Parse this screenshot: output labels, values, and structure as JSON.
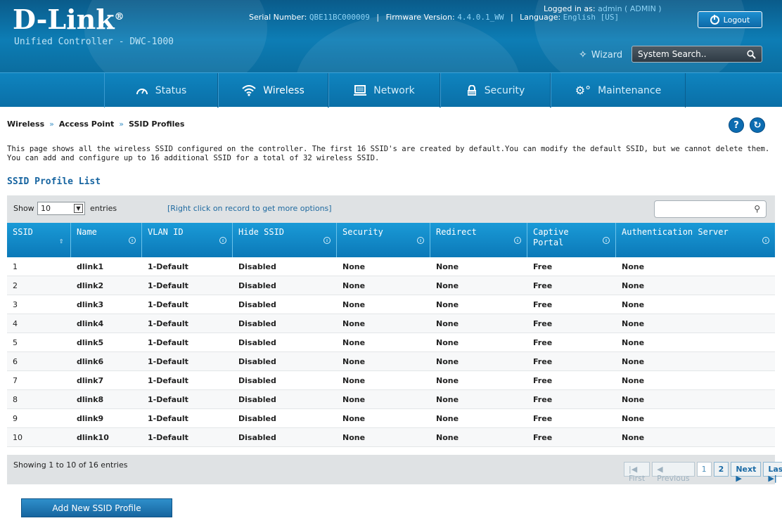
{
  "header": {
    "logo": "D-Link",
    "logo_mark": "®",
    "product": "Unified Controller - DWC-1000",
    "serial_label": "Serial Number:",
    "serial_value": "QBE11BC000009",
    "firmware_label": "Firmware Version:",
    "firmware_value": "4.4.0.1_WW",
    "language_label": "Language:",
    "language_value": "English [US]",
    "logged_in_label": "Logged in as:",
    "logged_in_value": "admin ( ADMIN )",
    "logout_label": "Logout",
    "wizard_label": "Wizard",
    "search_placeholder": "System Search.."
  },
  "nav": {
    "items": [
      {
        "label": "Status",
        "icon": "gauge-icon"
      },
      {
        "label": "Wireless",
        "icon": "wifi-icon"
      },
      {
        "label": "Network",
        "icon": "monitor-icon"
      },
      {
        "label": "Security",
        "icon": "lock-icon"
      },
      {
        "label": "Maintenance",
        "icon": "gears-icon"
      }
    ],
    "active": "Wireless"
  },
  "breadcrumb": [
    "Wireless",
    "Access Point",
    "SSID Profiles"
  ],
  "description": "This page shows all the wireless SSID configured on the controller. The first 16 SSID's are created by default.You can modify the default SSID, but we cannot delete them. You can add and configure up to 16 additional SSID for a total of 32 wireless SSID.",
  "section_title": "SSID Profile List",
  "toolbar": {
    "show_label": "Show",
    "show_value": "10",
    "entries_label": "entries",
    "hint": "[Right click on record to get more options]"
  },
  "table": {
    "columns": [
      "SSID",
      "Name",
      "VLAN ID",
      "Hide SSID",
      "Security",
      "Redirect",
      "Captive Portal",
      "Authentication Server"
    ],
    "rows": [
      [
        "1",
        "dlink1",
        "1-Default",
        "Disabled",
        "None",
        "None",
        "Free",
        "None"
      ],
      [
        "2",
        "dlink2",
        "1-Default",
        "Disabled",
        "None",
        "None",
        "Free",
        "None"
      ],
      [
        "3",
        "dlink3",
        "1-Default",
        "Disabled",
        "None",
        "None",
        "Free",
        "None"
      ],
      [
        "4",
        "dlink4",
        "1-Default",
        "Disabled",
        "None",
        "None",
        "Free",
        "None"
      ],
      [
        "5",
        "dlink5",
        "1-Default",
        "Disabled",
        "None",
        "None",
        "Free",
        "None"
      ],
      [
        "6",
        "dlink6",
        "1-Default",
        "Disabled",
        "None",
        "None",
        "Free",
        "None"
      ],
      [
        "7",
        "dlink7",
        "1-Default",
        "Disabled",
        "None",
        "None",
        "Free",
        "None"
      ],
      [
        "8",
        "dlink8",
        "1-Default",
        "Disabled",
        "None",
        "None",
        "Free",
        "None"
      ],
      [
        "9",
        "dlink9",
        "1-Default",
        "Disabled",
        "None",
        "None",
        "Free",
        "None"
      ],
      [
        "10",
        "dlink10",
        "1-Default",
        "Disabled",
        "None",
        "None",
        "Free",
        "None"
      ]
    ]
  },
  "footer": {
    "showing": "Showing 1 to 10 of 16 entries",
    "first": "First",
    "previous": "Previous",
    "pages": [
      "1",
      "2"
    ],
    "next": "Next",
    "last": "Last"
  },
  "add_button": "Add New SSID Profile",
  "colors": {
    "header_blue": "#0d7db5",
    "nav_blue": "#0a6fa7",
    "table_header": "#1a9ad7",
    "link_blue": "#1664a0"
  }
}
